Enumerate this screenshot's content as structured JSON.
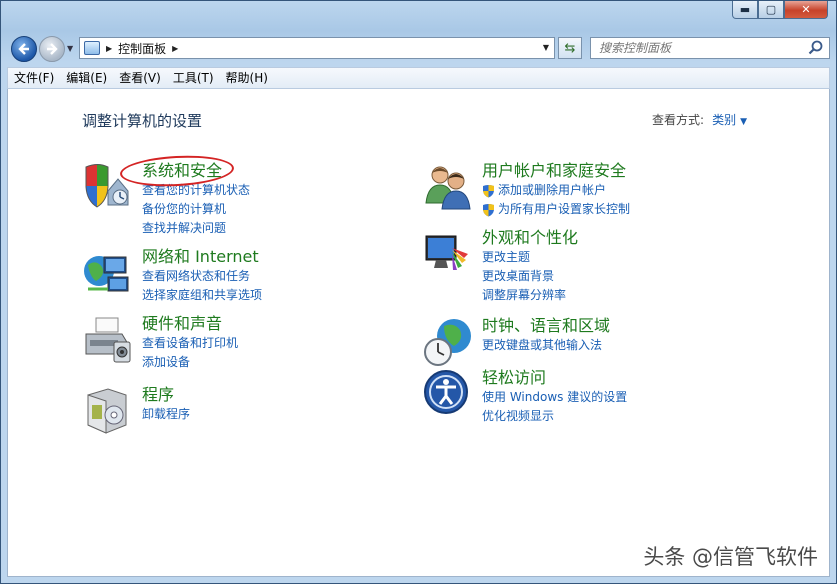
{
  "window": {
    "buttons": {
      "minimize": "▬",
      "maximize": "▢",
      "close": "✕"
    }
  },
  "navbar": {
    "breadcrumb": "控制面板",
    "search_placeholder": "搜索控制面板"
  },
  "menu": [
    "文件(F)",
    "编辑(E)",
    "查看(V)",
    "工具(T)",
    "帮助(H)"
  ],
  "main": {
    "title": "调整计算机的设置",
    "view_by_label": "查看方式:",
    "view_by_value": "类别"
  },
  "categories": {
    "system": {
      "title": "系统和安全",
      "links": [
        "查看您的计算机状态",
        "备份您的计算机",
        "查找并解决问题"
      ],
      "icon": "shield-security-icon"
    },
    "network": {
      "title": "网络和 Internet",
      "links": [
        "查看网络状态和任务",
        "选择家庭组和共享选项"
      ],
      "icon": "network-globe-icon"
    },
    "hardware": {
      "title": "硬件和声音",
      "links": [
        "查看设备和打印机",
        "添加设备"
      ],
      "icon": "printer-icon"
    },
    "programs": {
      "title": "程序",
      "links": [
        "卸载程序"
      ],
      "icon": "programs-box-icon"
    },
    "users": {
      "title": "用户帐户和家庭安全",
      "links": [
        "添加或删除用户帐户",
        "为所有用户设置家长控制"
      ],
      "icon": "users-icon"
    },
    "appearance": {
      "title": "外观和个性化",
      "links": [
        "更改主题",
        "更改桌面背景",
        "调整屏幕分辨率"
      ],
      "icon": "monitor-palette-icon"
    },
    "clock": {
      "title": "时钟、语言和区域",
      "links": [
        "更改键盘或其他输入法"
      ],
      "icon": "clock-globe-icon"
    },
    "ease": {
      "title": "轻松访问",
      "links": [
        "使用 Windows 建议的设置",
        "优化视频显示"
      ],
      "icon": "ease-of-access-icon"
    }
  },
  "watermark": "头条 @信管飞软件",
  "colors": {
    "title_green": "#1e7a1e",
    "link_blue": "#1a5fb4",
    "circle_red": "#d42424"
  }
}
